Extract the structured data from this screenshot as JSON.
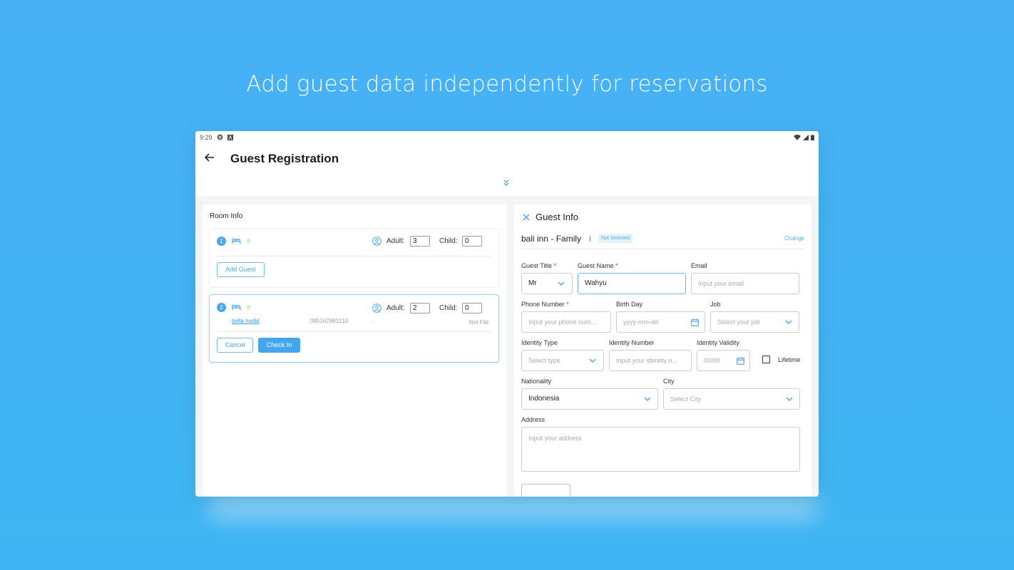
{
  "headline": "Add guest data independently for reservations",
  "status_bar": {
    "time": "9:29"
  },
  "app_bar": {
    "title": "Guest Registration"
  },
  "room_info": {
    "title": "Room Info",
    "rooms": [
      {
        "number": "1",
        "status": "-",
        "adult_label": "Adult:",
        "adult": "3",
        "child_label": "Child:",
        "child": "0",
        "add_guest_label": "Add Guest"
      },
      {
        "number": "2",
        "status": "-",
        "adult_label": "Adult:",
        "adult": "2",
        "child_label": "Child:",
        "child": "0",
        "guest": {
          "name": "bella hadid",
          "phone": "085162981210",
          "id": "-",
          "file_status": "Not File"
        },
        "cancel_label": "Cancel",
        "checkin_label": "Check In"
      }
    ]
  },
  "guest_info": {
    "title": "Guest Info",
    "room_name": "bali inn - Family",
    "status_badge": "Not Selected",
    "change_label": "Change",
    "fields": {
      "guest_title": {
        "label": "Guest Title",
        "value": "Mr"
      },
      "guest_name": {
        "label": "Guest Name",
        "value": "Wahyu"
      },
      "email": {
        "label": "Email",
        "placeholder": "Input your email"
      },
      "phone": {
        "label": "Phone Number",
        "placeholder": "Input your phone num..."
      },
      "birthday": {
        "label": "Birth Day",
        "placeholder": "yyyy-mm-dd"
      },
      "job": {
        "label": "Job",
        "placeholder": "Select your job"
      },
      "identity_type": {
        "label": "Identity Type",
        "placeholder": "Select type"
      },
      "identity_number": {
        "label": "Identity Number",
        "placeholder": "Input your identity n..."
      },
      "identity_validity": {
        "label": "Identity Validity",
        "placeholder": "00/00"
      },
      "lifetime": {
        "label": "Lifetime",
        "checked": false
      },
      "nationality": {
        "label": "Nationality",
        "value": "Indonesia"
      },
      "city": {
        "label": "City",
        "placeholder": "Select City"
      },
      "address": {
        "label": "Address",
        "placeholder": "Input your address"
      }
    },
    "required_marker": "*"
  },
  "colors": {
    "accent": "#45a6ee",
    "background": "#45b2f4",
    "required": "#e53935"
  }
}
